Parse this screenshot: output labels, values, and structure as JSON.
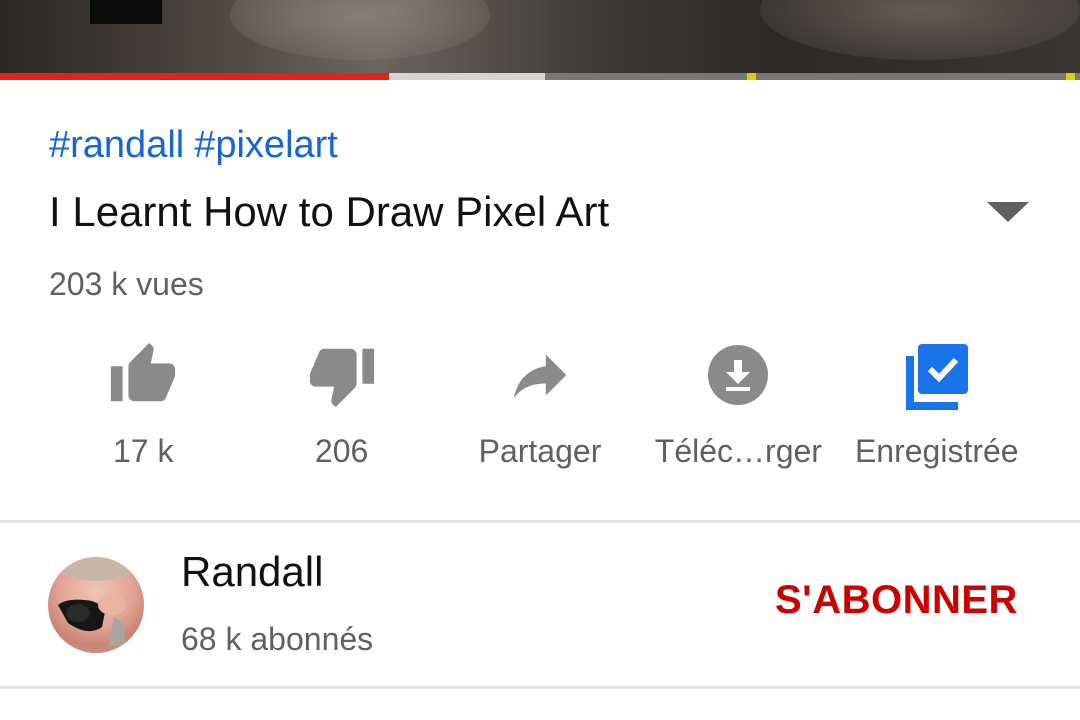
{
  "video": {
    "progress_played_fraction": 0.36,
    "progress_buffered_fraction": 0.505,
    "ad_markers_fraction": [
      0.7,
      0.995
    ],
    "colors": {
      "played": "#e62117",
      "ad_marker": "#d9d200"
    }
  },
  "hashtags": [
    "#randall",
    "#pixelart"
  ],
  "title": "I Learnt How to Draw Pixel Art",
  "views": "203 k vues",
  "actions": [
    {
      "icon": "thumb-up-icon",
      "label": "17 k"
    },
    {
      "icon": "thumb-down-icon",
      "label": "206"
    },
    {
      "icon": "share-icon",
      "label": "Partager"
    },
    {
      "icon": "download-icon",
      "label": "Téléc…rger"
    },
    {
      "icon": "saved-playlist-icon",
      "label": "Enregistrée"
    }
  ],
  "channel": {
    "name": "Randall",
    "subscribers": "68 k abonnés",
    "subscribe_label": "S'ABONNER"
  },
  "colors": {
    "hashtag": "#1565d8",
    "subscribe": "#cc0000",
    "saved_icon": "#1a73e8"
  }
}
